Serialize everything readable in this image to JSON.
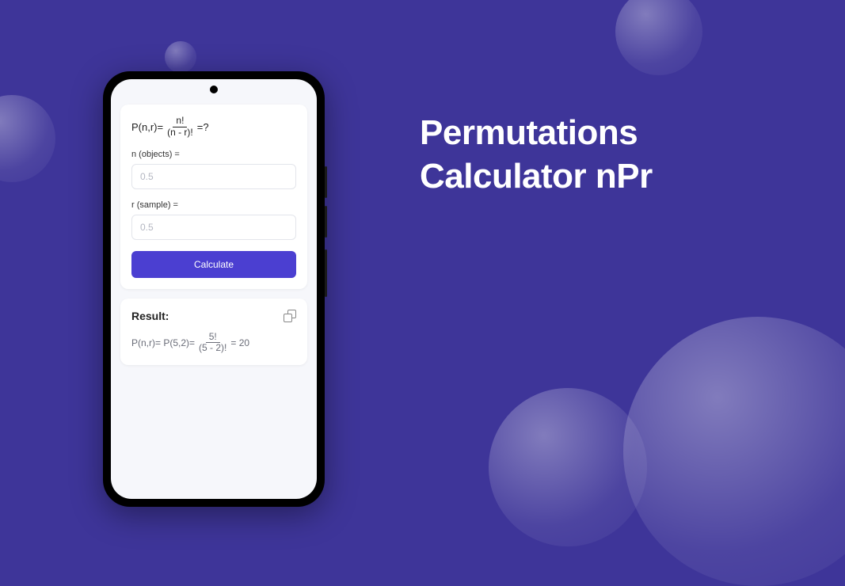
{
  "hero": {
    "title_line1": "Permutations",
    "title_line2": "Calculator nPr"
  },
  "formula": {
    "lhs": "P(n,r)=",
    "numerator": "n!",
    "denominator": "(n - r)!",
    "tail": "=?"
  },
  "inputs": {
    "n_label": "n (objects) =",
    "n_placeholder": "0.5",
    "r_label": "r (sample) =",
    "r_placeholder": "0.5"
  },
  "button": {
    "calculate": "Calculate"
  },
  "result": {
    "heading": "Result:",
    "prefix": "P(n,r)= P(5,2)=",
    "numerator": "5!",
    "denominator": "(5 - 2)!",
    "equals_value": "= 20"
  },
  "colors": {
    "background": "#3e3599",
    "accent": "#4b3fd1"
  }
}
